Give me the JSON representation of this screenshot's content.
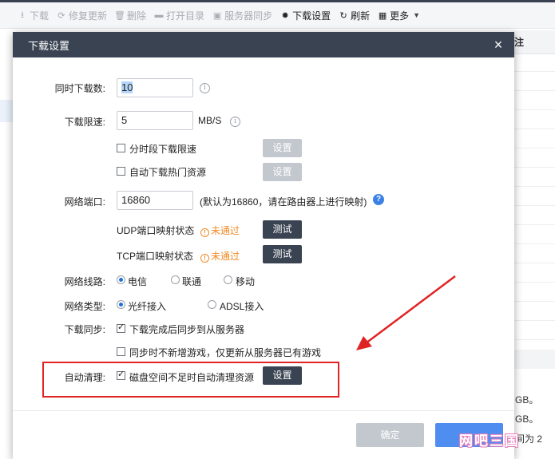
{
  "toolbar": {
    "items": [
      {
        "label": "下载",
        "icon": "download-icon",
        "glyph": "⭳",
        "enabled": false
      },
      {
        "label": "修复更新",
        "icon": "repair-icon",
        "glyph": "⟳",
        "enabled": false
      },
      {
        "label": "删除",
        "icon": "trash-icon",
        "glyph": "🗑",
        "enabled": false
      },
      {
        "label": "打开目录",
        "icon": "folder-icon",
        "glyph": "▬",
        "enabled": false
      },
      {
        "label": "服务器同步",
        "icon": "server-sync-icon",
        "glyph": "▣",
        "enabled": false
      },
      {
        "label": "下载设置",
        "icon": "gear-icon",
        "glyph": "✹",
        "enabled": true
      },
      {
        "label": "刷新",
        "icon": "refresh-icon",
        "glyph": "↻",
        "enabled": true
      },
      {
        "label": "更多",
        "icon": "grid-icon",
        "glyph": "▦",
        "enabled": true
      }
    ]
  },
  "background": {
    "column_header": "注",
    "texts": [
      "GB。",
      "GB。",
      "间为 2"
    ]
  },
  "dialog": {
    "title": "下载设置",
    "close_glyph": "×",
    "concurrent_label": "同时下载数:",
    "concurrent_value": "10",
    "speed_label": "下载限速:",
    "speed_value": "5",
    "speed_unit": "MB/S",
    "timed_limit_label": "分时段下载限速",
    "hot_resource_label": "自动下载热门资源",
    "settings_label": "设置",
    "port_label": "网络端口:",
    "port_value": "16860",
    "port_hint": "(默认为16860，请在路由器上进行映射)",
    "help_glyph": "?",
    "info_glyph": "i",
    "udp_label": "UDP端口映射状态",
    "tcp_label": "TCP端口映射状态",
    "status_failed": "未通过",
    "warn_glyph": "!",
    "test_label": "测试",
    "line_label": "网络线路:",
    "line_options": [
      "电信",
      "联通",
      "移动"
    ],
    "line_selected": 0,
    "type_label": "网络类型:",
    "type_options": [
      "光纤接入",
      "ADSL接入"
    ],
    "type_selected": 0,
    "sync_label": "下载同步:",
    "sync_after_label": "下载完成后同步到从服务器",
    "sync_after_checked": true,
    "sync_no_new_label": "同步时不新增游戏，仅更新从服务器已有游戏",
    "sync_no_new_checked": false,
    "clean_label": "自动清理:",
    "clean_checkbox_label": "磁盘空间不足时自动清理资源",
    "clean_checked": true,
    "ok_label": "确定"
  },
  "watermark": "网吧三国",
  "colors": {
    "header_bg": "#3a4352",
    "accent_blue": "#4f8df0",
    "warning_orange": "#f08a24",
    "annotation_red": "#e02424"
  }
}
